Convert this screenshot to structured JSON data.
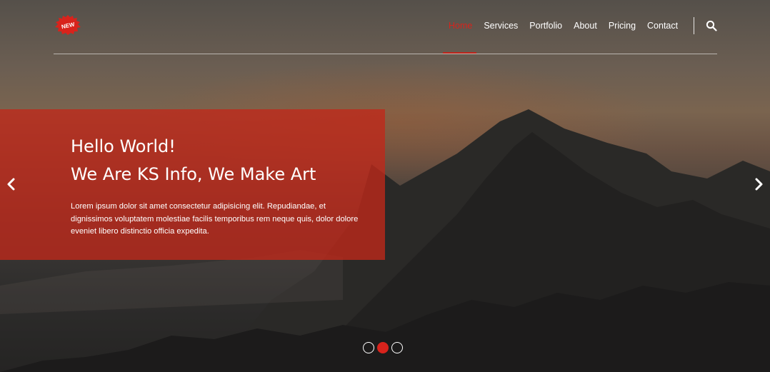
{
  "brand": {
    "logo_text": "NEW",
    "logo_color": "#d8231c"
  },
  "nav": {
    "items": [
      {
        "label": "Home",
        "active": true
      },
      {
        "label": "Services",
        "active": false
      },
      {
        "label": "Portfolio",
        "active": false
      },
      {
        "label": "About",
        "active": false
      },
      {
        "label": "Pricing",
        "active": false
      },
      {
        "label": "Contact",
        "active": false
      }
    ],
    "search_icon": "search-icon"
  },
  "slider": {
    "title_line1": "Hello World!",
    "title_line2": "We Are KS Info, We Make Art",
    "description": "Lorem ipsum dolor sit amet consectetur adipisicing elit. Repudiandae, et dignissimos voluptatem molestiae facilis temporibus rem neque quis, dolor dolore eveniet libero distinctio officia expedita.",
    "prev_icon": "chevron-left-icon",
    "next_icon": "chevron-right-icon",
    "slide_count": 3,
    "active_slide": 2,
    "accent_color": "#d8231c"
  }
}
